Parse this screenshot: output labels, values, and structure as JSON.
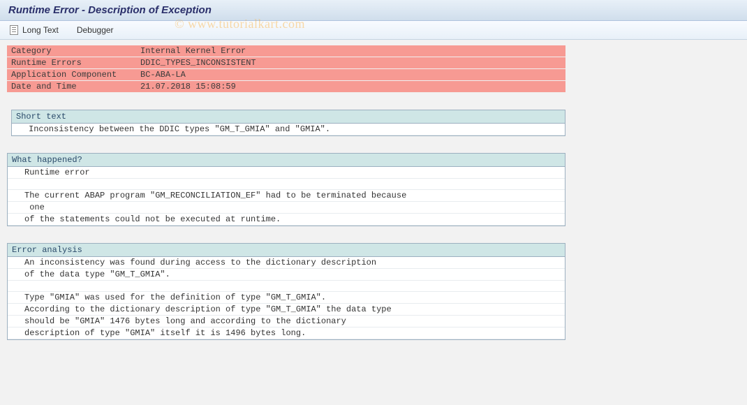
{
  "title": "Runtime Error - Description of Exception",
  "toolbar": {
    "long_text": "Long Text",
    "debugger": "Debugger"
  },
  "watermark": "© www.tutorialkart.com",
  "error_rows": [
    {
      "label": "Category",
      "value": "Internal Kernel Error"
    },
    {
      "label": "Runtime Errors",
      "value": "DDIC_TYPES_INCONSISTENT"
    },
    {
      "label": "Application Component",
      "value": "BC-ABA-LA"
    },
    {
      "label": "Date and Time",
      "value": "21.07.2018 15:08:59"
    }
  ],
  "sections": {
    "short_text": {
      "title": "Short text",
      "lines": [
        "Inconsistency between the DDIC types \"GM_T_GMIA\" and \"GMIA\"."
      ]
    },
    "what_happened": {
      "title": "What happened?",
      "lines": [
        "Runtime error",
        "",
        "The current ABAP program \"GM_RECONCILIATION_EF\" had to be terminated because",
        " one",
        "of the statements could not be executed at runtime."
      ]
    },
    "error_analysis": {
      "title": "Error analysis",
      "lines": [
        "An inconsistency was found during access to the dictionary description",
        "of the data type \"GM_T_GMIA\".",
        "",
        "Type \"GMIA\" was used for the definition of type \"GM_T_GMIA\".",
        "According to the dictionary description of type \"GM_T_GMIA\" the data type",
        "should be \"GMIA\" 1476 bytes long and according to the dictionary",
        "description of type \"GMIA\" itself it is 1496 bytes long."
      ]
    }
  }
}
